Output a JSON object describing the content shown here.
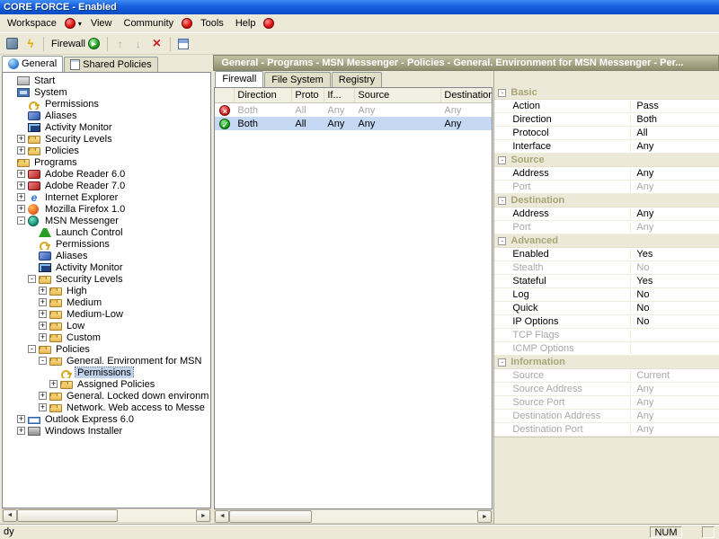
{
  "window": {
    "title": "CORE FORCE - Enabled"
  },
  "menubar": {
    "items": [
      {
        "label": "Workspace"
      },
      {
        "icon": "red-status",
        "caret": true
      },
      {
        "label": "View"
      },
      {
        "label": "Community"
      },
      {
        "icon": "red-status"
      },
      {
        "label": "Tools"
      },
      {
        "label": "Help"
      },
      {
        "icon": "red-status"
      }
    ]
  },
  "toolbar": {
    "items": [
      {
        "name": "options",
        "icon": "options"
      },
      {
        "name": "apply",
        "icon": "lightning"
      },
      {
        "sep": true
      },
      {
        "name": "firewall-mode",
        "label": "Firewall",
        "icon": "green-status"
      },
      {
        "sep": true
      },
      {
        "name": "move-up",
        "icon": "move-up",
        "disabled": true
      },
      {
        "name": "move-down",
        "icon": "move-down",
        "disabled": true
      },
      {
        "name": "delete",
        "icon": "delete"
      },
      {
        "sep": true
      },
      {
        "name": "report",
        "icon": "report"
      }
    ]
  },
  "left_panel": {
    "tabs": [
      {
        "label": "General",
        "icon": "general",
        "active": true
      },
      {
        "label": "Shared Policies",
        "icon": "shared",
        "active": false
      }
    ]
  },
  "tree": {
    "items": [
      {
        "label": "Start",
        "indent": 0,
        "icon": "start",
        "expand": null,
        "selected": false
      },
      {
        "label": "System",
        "indent": 0,
        "icon": "system",
        "expand": null,
        "selected": false
      },
      {
        "label": "Permissions",
        "indent": 1,
        "icon": "permissions",
        "expand": null,
        "selected": false
      },
      {
        "label": "Aliases",
        "indent": 1,
        "icon": "aliases",
        "expand": null,
        "selected": false
      },
      {
        "label": "Activity Monitor",
        "indent": 1,
        "icon": "monitor",
        "expand": null,
        "selected": false
      },
      {
        "label": "Security Levels",
        "indent": 1,
        "icon": "seclevels",
        "expand": "+",
        "selected": false
      },
      {
        "label": "Policies",
        "indent": 1,
        "icon": "folder",
        "expand": "+",
        "selected": false
      },
      {
        "label": "Programs",
        "indent": 0,
        "icon": "programs",
        "expand": null,
        "selected": false
      },
      {
        "label": "Adobe Reader 6.0",
        "indent": 1,
        "icon": "adobe",
        "expand": "+",
        "selected": false
      },
      {
        "label": "Adobe Reader 7.0",
        "indent": 1,
        "icon": "adobe",
        "expand": "+",
        "selected": false
      },
      {
        "label": "Internet Explorer",
        "indent": 1,
        "icon": "ie",
        "expand": "+",
        "selected": false
      },
      {
        "label": "Mozilla Firefox 1.0",
        "indent": 1,
        "icon": "firefox",
        "expand": "+",
        "selected": false
      },
      {
        "label": "MSN Messenger",
        "indent": 1,
        "icon": "msn",
        "expand": "-",
        "selected": false
      },
      {
        "label": "Launch Control",
        "indent": 2,
        "icon": "launch",
        "expand": null,
        "selected": false
      },
      {
        "label": "Permissions",
        "indent": 2,
        "icon": "permissions",
        "expand": null,
        "selected": false
      },
      {
        "label": "Aliases",
        "indent": 2,
        "icon": "aliases",
        "expand": null,
        "selected": false
      },
      {
        "label": "Activity Monitor",
        "indent": 2,
        "icon": "monitor",
        "expand": null,
        "selected": false
      },
      {
        "label": "Security Levels",
        "indent": 2,
        "icon": "seclevels",
        "expand": "-",
        "selected": false
      },
      {
        "label": "High",
        "indent": 3,
        "icon": "level",
        "expand": "+",
        "selected": false
      },
      {
        "label": "Medium",
        "indent": 3,
        "icon": "level",
        "expand": "+",
        "selected": false
      },
      {
        "label": "Medium-Low",
        "indent": 3,
        "icon": "level",
        "expand": "+",
        "selected": false
      },
      {
        "label": "Low",
        "indent": 3,
        "icon": "level",
        "expand": "+",
        "selected": false
      },
      {
        "label": "Custom",
        "indent": 3,
        "icon": "level",
        "expand": "+",
        "selected": false
      },
      {
        "label": "Policies",
        "indent": 2,
        "icon": "folder",
        "expand": "-",
        "selected": false
      },
      {
        "label": "General. Environment for MSN",
        "indent": 3,
        "icon": "folder",
        "expand": "-",
        "selected": false
      },
      {
        "label": "Permissions",
        "indent": 4,
        "icon": "permissions",
        "expand": null,
        "selected": true
      },
      {
        "label": "Assigned Policies",
        "indent": 4,
        "icon": "folder",
        "expand": "+",
        "selected": false
      },
      {
        "label": "General. Locked down environm",
        "indent": 3,
        "icon": "folder",
        "expand": "+",
        "selected": false
      },
      {
        "label": "Network. Web access to Messe",
        "indent": 3,
        "icon": "folder",
        "expand": "+",
        "selected": false
      },
      {
        "label": "Outlook Express 6.0",
        "indent": 1,
        "icon": "outlook",
        "expand": "+",
        "selected": false
      },
      {
        "label": "Windows Installer",
        "indent": 1,
        "icon": "installer",
        "expand": "+",
        "selected": false
      }
    ]
  },
  "breadcrumb": "General - Programs - MSN Messenger - Policies - General. Environment for MSN Messenger - Per...",
  "content_tabs": [
    {
      "label": "Firewall",
      "active": true
    },
    {
      "label": "File System",
      "active": false
    },
    {
      "label": "Registry",
      "active": false
    }
  ],
  "table": {
    "columns": [
      "",
      "Direction",
      "Proto",
      "If...",
      "Source",
      "Destination"
    ],
    "rows": [
      {
        "icon": "deny",
        "cells": [
          "Both",
          "All",
          "Any",
          "Any",
          "Any"
        ],
        "disabled": true,
        "selected": false
      },
      {
        "icon": "allow",
        "cells": [
          "Both",
          "All",
          "Any",
          "Any",
          "Any"
        ],
        "disabled": false,
        "selected": true
      }
    ]
  },
  "properties": {
    "groups": [
      {
        "name": "Basic",
        "items": [
          {
            "name": "Action",
            "value": "Pass",
            "gray": false
          },
          {
            "name": "Direction",
            "value": "Both",
            "gray": false
          },
          {
            "name": "Protocol",
            "value": "All",
            "gray": false
          },
          {
            "name": "Interface",
            "value": "Any",
            "gray": false
          }
        ]
      },
      {
        "name": "Source",
        "items": [
          {
            "name": "Address",
            "value": "Any",
            "gray": false
          },
          {
            "name": "Port",
            "value": "Any",
            "gray": true
          }
        ]
      },
      {
        "name": "Destination",
        "items": [
          {
            "name": "Address",
            "value": "Any",
            "gray": false
          },
          {
            "name": "Port",
            "value": "Any",
            "gray": true
          }
        ]
      },
      {
        "name": "Advanced",
        "items": [
          {
            "name": "Enabled",
            "value": "Yes",
            "gray": false
          },
          {
            "name": "Stealth",
            "value": "No",
            "gray": true
          },
          {
            "name": "Stateful",
            "value": "Yes",
            "gray": false
          },
          {
            "name": "Log",
            "value": "No",
            "gray": false
          },
          {
            "name": "Quick",
            "value": "No",
            "gray": false
          },
          {
            "name": "IP Options",
            "value": "No",
            "gray": false
          },
          {
            "name": "TCP Flags",
            "value": "",
            "gray": true
          },
          {
            "name": "ICMP Options",
            "value": "",
            "gray": true
          }
        ]
      },
      {
        "name": "Information",
        "items": [
          {
            "name": "Source",
            "value": "Current",
            "gray": true
          },
          {
            "name": "Source Address",
            "value": "Any",
            "gray": true
          },
          {
            "name": "Source Port",
            "value": "Any",
            "gray": true
          },
          {
            "name": "Destination Address",
            "value": "Any",
            "gray": true
          },
          {
            "name": "Destination Port",
            "value": "Any",
            "gray": true
          }
        ]
      }
    ]
  },
  "statusbar": {
    "text": "dy",
    "num": "NUM"
  },
  "colors": {
    "titlebar_blue": "#1660E0",
    "breadcrumb_olive": "#9A9A7A",
    "selection_blue": "#C6D9F4",
    "allow_green": "#18A018",
    "deny_red": "#D01818",
    "group_label_olive": "#A8A678"
  }
}
